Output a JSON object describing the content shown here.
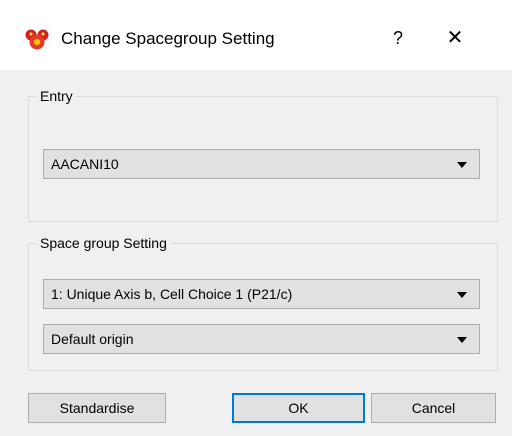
{
  "window": {
    "title": "Change Spacegroup Setting",
    "help_glyph": "?",
    "close_glyph": "✕",
    "app_icon": "mercury-app-icon"
  },
  "entry_group": {
    "label": "Entry",
    "combo_value": "AACANI10"
  },
  "spacegroup_group": {
    "label": "Space group Setting",
    "setting_value": "1: Unique Axis b, Cell Choice 1 (P21/c)",
    "origin_value": "Default origin"
  },
  "buttons": {
    "standardise": "Standardise",
    "ok": "OK",
    "cancel": "Cancel"
  },
  "colors": {
    "accent": "#0078d7"
  }
}
